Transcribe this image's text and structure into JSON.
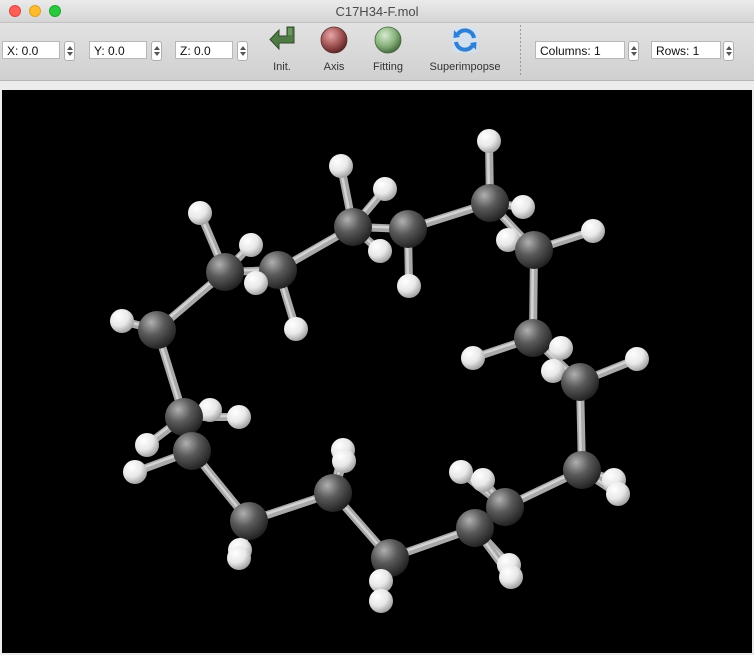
{
  "window": {
    "title": "C17H34-F.mol"
  },
  "toolbar": {
    "x_field": "X: 0.0",
    "y_field": "Y: 0.0",
    "z_field": "Z: 0.0",
    "init_label": "Init.",
    "axis_label": "Axis",
    "fitting_label": "Fitting",
    "superimpose_label": "Superimpopse",
    "columns_field": "Columns: 1",
    "rows_field": "Rows: 1"
  },
  "colors": {
    "viewer_background": "#000000",
    "carbon": "#4d4d4d",
    "hydrogen": "#f2f2f2",
    "bond": "#bdbdbd",
    "init_icon": "#4f7a45",
    "axis_icon": "#a05252",
    "fitting_icon": "#86b07a",
    "superimpose_icon": "#2f7fd6"
  },
  "icons": {
    "init": "green-return-arrow-icon",
    "axis": "red-ball-icon",
    "fitting": "green-ball-icon",
    "superimpose": "blue-refresh-icon"
  }
}
